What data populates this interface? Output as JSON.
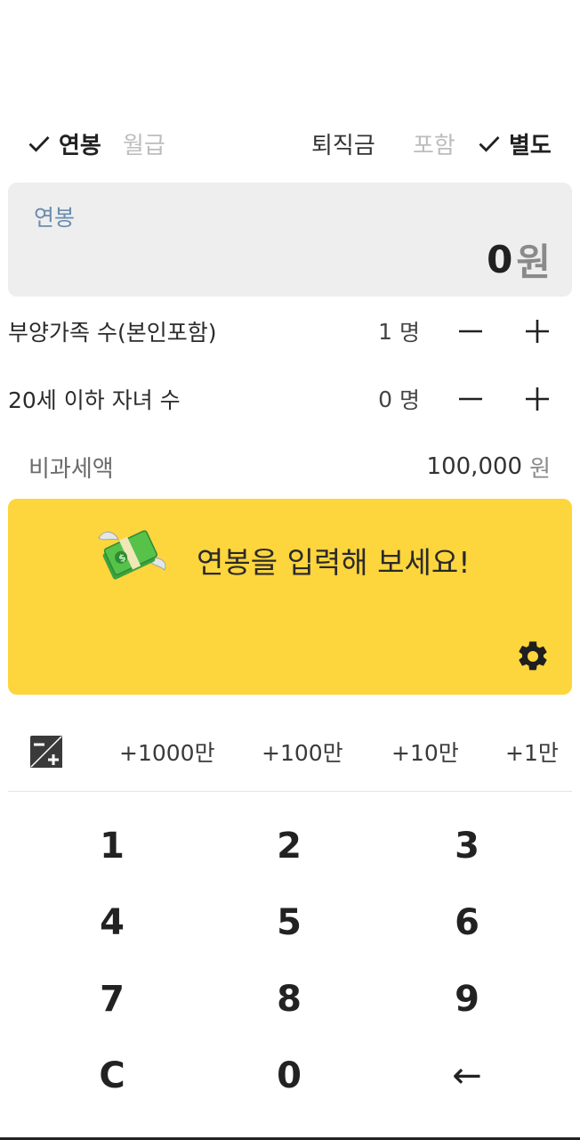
{
  "toggles": {
    "annual": "연봉",
    "monthly": "월급",
    "severance_label": "퇴직금",
    "include": "포함",
    "separate": "별도"
  },
  "salary_input": {
    "label": "연봉",
    "value": "0",
    "unit": "원"
  },
  "dependents": {
    "label": "부양가족 수(본인포함)",
    "count": "1",
    "unit": "명"
  },
  "children": {
    "label": "20세 이하 자녀 수",
    "count": "0",
    "unit": "명"
  },
  "tax_free": {
    "label": "비과세액",
    "value": "100,000",
    "unit": "원"
  },
  "result_card": {
    "message": "연봉을 입력해 보세요!",
    "icon": "flying-money-icon",
    "settings_icon": "gear-icon",
    "background": "#fdd53d"
  },
  "quick_add": [
    "+1000만",
    "+100만",
    "+10만",
    "+1만"
  ],
  "keypad": [
    "1",
    "2",
    "3",
    "4",
    "5",
    "6",
    "7",
    "8",
    "9",
    "C",
    "0",
    "←"
  ]
}
